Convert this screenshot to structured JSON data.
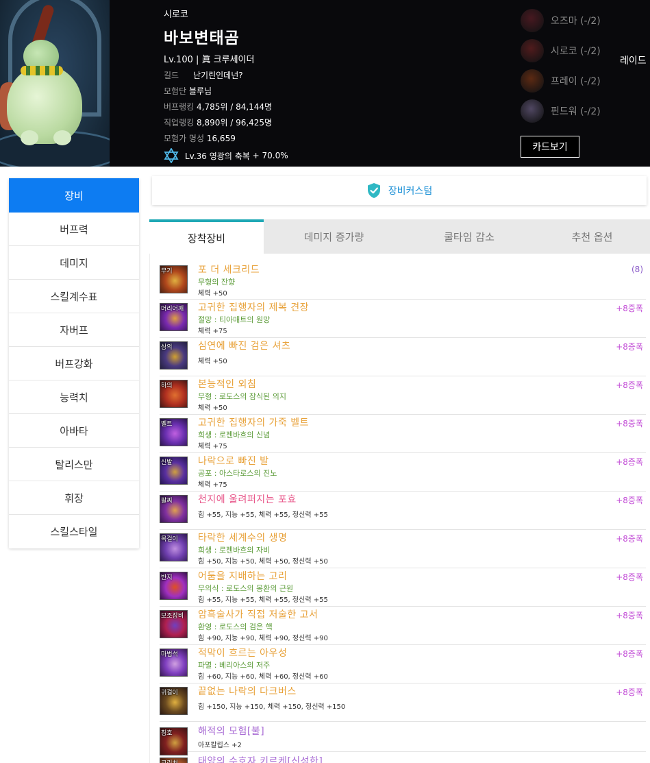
{
  "header": {
    "server": "시로코",
    "character_name": "바보변태곰",
    "level_text": "Lv.100",
    "separator": "|",
    "class_name": "眞 크루세이더",
    "guild_label": "길드",
    "guild_value": "난기린인데넌?",
    "adventure_label": "모험단",
    "adventure_value": "블루님",
    "buff_rank_label": "버프랭킹",
    "buff_rank_value": "4,785위 / 84,144명",
    "job_rank_label": "직업랭킹",
    "job_rank_value": "8,890위 / 96,425명",
    "fame_label": "모험가 명성",
    "fame_value": "16,659",
    "glory_text": "Lv.36 영광의 축복",
    "glory_value": "+ 70.0%",
    "raid_label": "레이드",
    "card_button": "카드보기",
    "raids": [
      {
        "name": "오즈마 (-/2)",
        "color": "#7a2530"
      },
      {
        "name": "시로코 (-/2)",
        "color": "#8a2a2a"
      },
      {
        "name": "프레이 (-/2)",
        "color": "#a04418"
      },
      {
        "name": "핀드워 (-/2)",
        "color": "#8a7aa8"
      }
    ]
  },
  "sidebar": {
    "items": [
      {
        "label": "장비",
        "active": true
      },
      {
        "label": "버프력"
      },
      {
        "label": "데미지"
      },
      {
        "label": "스킬계수표"
      },
      {
        "label": "자버프"
      },
      {
        "label": "버프강화"
      },
      {
        "label": "능력치"
      },
      {
        "label": "아바타"
      },
      {
        "label": "탈리스만"
      },
      {
        "label": "휘장"
      },
      {
        "label": "스킬스타일"
      }
    ]
  },
  "custom_bar": {
    "label": "장비커스텀"
  },
  "tabs": [
    {
      "label": "장착장비",
      "active": true
    },
    {
      "label": "데미지 증가량"
    },
    {
      "label": "쿨타임 감소"
    },
    {
      "label": "추천 옵션"
    }
  ],
  "equipment": [
    {
      "slot": "무기",
      "name": "포 더 세크리드",
      "name_color": "#e8a23a",
      "sub": "무형의 잔향",
      "stat": "체력 +50",
      "right": "(8)",
      "icon": [
        "#3a1a10",
        "#b0471c",
        "#e0b040"
      ]
    },
    {
      "slot": "머리어깨",
      "name": "고귀한 집행자의 제복 견장",
      "name_color": "#e8a23a",
      "sub": "절망 : 티아매트의 원망",
      "stat": "체력 +75",
      "right": "+8증폭",
      "icon": [
        "#2a1040",
        "#7a2ab0",
        "#e0a040"
      ]
    },
    {
      "slot": "상의",
      "name": "심연에 빠진 검은 셔츠",
      "name_color": "#e8a23a",
      "sub": "",
      "stat": "체력 +50",
      "right": "+8증폭",
      "icon": [
        "#1a1a30",
        "#4a3a80",
        "#d0a030"
      ]
    },
    {
      "slot": "하의",
      "name": "본능적인 외침",
      "name_color": "#e8a23a",
      "sub": "무형 : 로도스의 잠식된 의지",
      "stat": "체력 +50",
      "right": "+8증폭",
      "icon": [
        "#301010",
        "#b03020",
        "#e07030"
      ]
    },
    {
      "slot": "벨트",
      "name": "고귀한 집행자의 가죽 벨트",
      "name_color": "#e8a23a",
      "sub": "희생 : 로젠바흐의 신념",
      "stat": "체력 +75",
      "right": "+8증폭",
      "icon": [
        "#20103a",
        "#6a30b0",
        "#c060e0"
      ]
    },
    {
      "slot": "신발",
      "name": "나락으로 빠진 발",
      "name_color": "#e8a23a",
      "sub": "공포 : 아스타로스의 진노",
      "stat": "체력 +75",
      "right": "+8증폭",
      "icon": [
        "#1a1040",
        "#5a30a0",
        "#d0a040"
      ]
    },
    {
      "slot": "팔찌",
      "name": "천지에 울려퍼지는 포효",
      "name_color": "#e8578a",
      "sub": "",
      "stat": "힘 +55, 지능 +55, 체력 +55, 정신력 +55",
      "right": "+8증폭",
      "icon": [
        "#2a1040",
        "#8030a0",
        "#e0a050"
      ]
    },
    {
      "slot": "목걸이",
      "name": "타락한 세계수의 생명",
      "name_color": "#e8a23a",
      "sub": "희생 : 로젠바흐의 자비",
      "stat": "힘 +50, 지능 +50, 체력 +50, 정신력 +50",
      "right": "+8증폭",
      "icon": [
        "#20103a",
        "#7040b0",
        "#c090e0"
      ]
    },
    {
      "slot": "반지",
      "name": "어둠을 지배하는 고리",
      "name_color": "#e8a23a",
      "sub": "무의식 : 로도스의 몽환의 근원",
      "stat": "힘 +55, 지능 +55, 체력 +55, 정신력 +55",
      "right": "+8증폭",
      "icon": [
        "#200a30",
        "#a030c0",
        "#e05020"
      ]
    },
    {
      "slot": "보조장비",
      "name": "암흑술사가 직접 저술한 고서",
      "name_color": "#e8a23a",
      "sub": "환영 : 로도스의 검은 핵",
      "stat": "힘 +90, 지능 +90, 체력 +90, 정신력 +90",
      "right": "+8증폭",
      "icon": [
        "#300a20",
        "#b02050",
        "#7040c0"
      ]
    },
    {
      "slot": "마법석",
      "name": "적막이 흐르는 아우성",
      "name_color": "#e8a23a",
      "sub": "파멸 : 베리아스의 저주",
      "stat": "힘 +60, 지능 +60, 체력 +60, 정신력 +60",
      "right": "+8증폭",
      "icon": [
        "#2a1040",
        "#8040c0",
        "#d0a0e0"
      ]
    },
    {
      "slot": "귀걸이",
      "name": "끝없는 나락의 다크버스",
      "name_color": "#e8a23a",
      "sub": "",
      "stat": "힘 +150, 지능 +150, 체력 +150, 정신력 +150",
      "right": "+8증폭",
      "icon": [
        "#201010",
        "#6a4a20",
        "#e0b040"
      ]
    },
    {
      "slot": "칭호",
      "name": "해적의 모험[불]",
      "name_color": "#a86bd4",
      "sub": "",
      "stat": "아포칼립스 +2",
      "right": "",
      "icon": [
        "#301010",
        "#802020",
        "#d0a040"
      ]
    },
    {
      "slot": "크리쳐",
      "name": "태양의 수호자 키르케[신성한]",
      "name_color": "#a86bd4",
      "sub": "",
      "stat": "",
      "right": "",
      "icon": [
        "#402010",
        "#c06030",
        "#f0c060"
      ]
    }
  ]
}
